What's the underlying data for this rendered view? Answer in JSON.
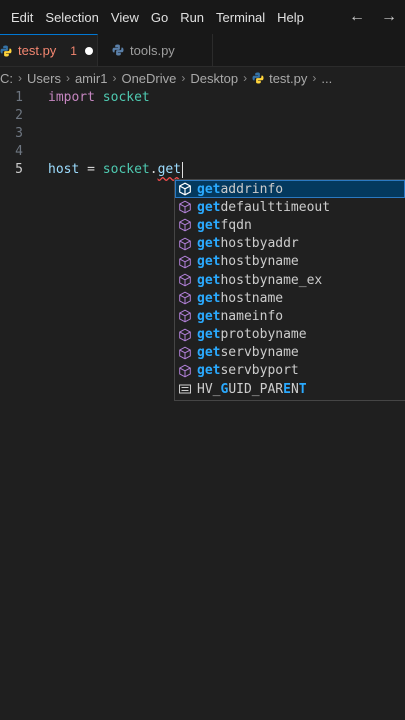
{
  "menu": [
    "Edit",
    "Selection",
    "View",
    "Go",
    "Run",
    "Terminal",
    "Help"
  ],
  "tabs": [
    {
      "label": "test.py",
      "problems": "1"
    },
    {
      "label": "tools.py"
    }
  ],
  "breadcrumb": [
    "C:",
    "Users",
    "amir1",
    "OneDrive",
    "Desktop",
    "test.py",
    "..."
  ],
  "code": {
    "lines": [
      {
        "num": "1",
        "kw": "import",
        "mod": "socket"
      },
      {
        "num": "2"
      },
      {
        "num": "3"
      },
      {
        "num": "4"
      },
      {
        "num": "5",
        "var": "host",
        "op": " = ",
        "obj": "socket",
        "dot": ".",
        "typed": "get"
      }
    ]
  },
  "suggestions": {
    "prefix": "get",
    "items": [
      {
        "rest": "addrinfo",
        "kind": "method"
      },
      {
        "rest": "defaulttimeout",
        "kind": "method"
      },
      {
        "rest": "fqdn",
        "kind": "method"
      },
      {
        "rest": "hostbyaddr",
        "kind": "method"
      },
      {
        "rest": "hostbyname",
        "kind": "method"
      },
      {
        "rest": "hostbyname_ex",
        "kind": "method"
      },
      {
        "rest": "hostname",
        "kind": "method"
      },
      {
        "rest": "nameinfo",
        "kind": "method"
      },
      {
        "rest": "protobyname",
        "kind": "method"
      },
      {
        "rest": "servbyname",
        "kind": "method"
      },
      {
        "rest": "servbyport",
        "kind": "method"
      }
    ],
    "last": {
      "pre": "HV_",
      "m1": "G",
      "mid": "UID_PAR",
      "m2": "E",
      "mid2": "N",
      "m3": "T",
      "kind": "constant"
    }
  },
  "colors": {
    "accent": "#0078d4",
    "selection": "#04395e",
    "match": "#2aaaff",
    "error": "#f48771"
  }
}
